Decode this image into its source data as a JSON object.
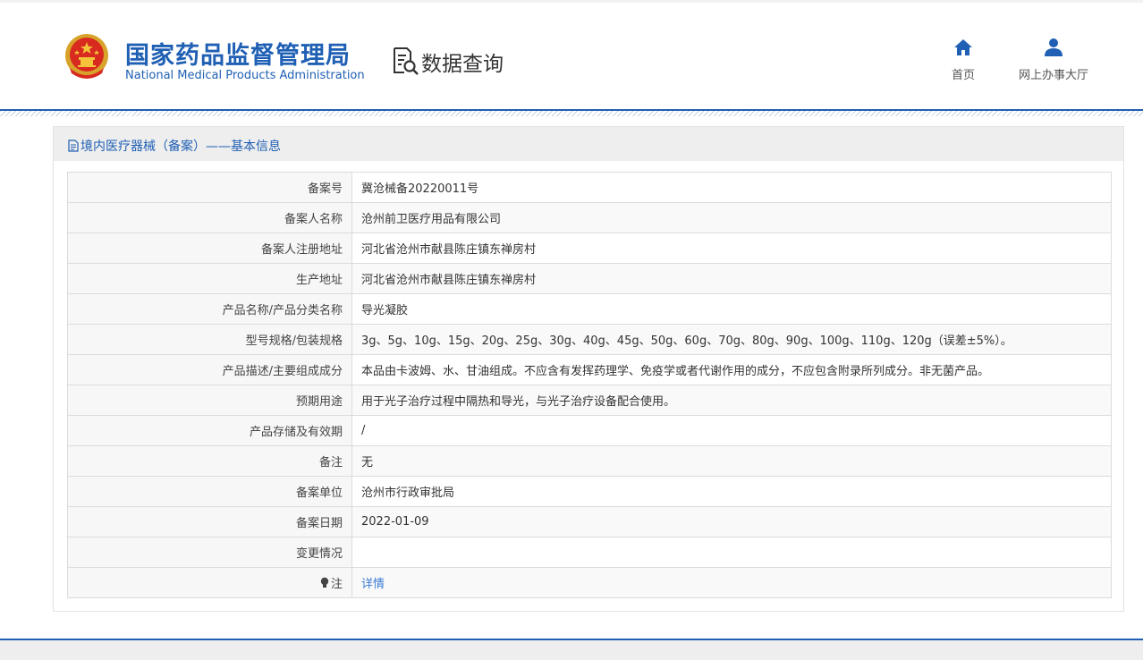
{
  "header": {
    "org_name_cn": "国家药品监督管理局",
    "org_name_en": "National Medical Products Administration",
    "section_title": "数据查询",
    "nav": {
      "home_label": "首页",
      "service_hall_label": "网上办事大厅"
    }
  },
  "panel": {
    "title": "境内医疗器械（备案）——基本信息"
  },
  "records": [
    {
      "label": "备案号",
      "value": "冀沧械备20220011号"
    },
    {
      "label": "备案人名称",
      "value": "沧州前卫医疗用品有限公司"
    },
    {
      "label": "备案人注册地址",
      "value": "河北省沧州市献县陈庄镇东禅房村"
    },
    {
      "label": "生产地址",
      "value": "河北省沧州市献县陈庄镇东禅房村"
    },
    {
      "label": "产品名称/产品分类名称",
      "value": "导光凝胶"
    },
    {
      "label": "型号规格/包装规格",
      "value": "3g、5g、10g、15g、20g、25g、30g、40g、45g、50g、60g、70g、80g、90g、100g、110g、120g（误差±5%）。"
    },
    {
      "label": "产品描述/主要组成成分",
      "value": "本品由卡波姆、水、甘油组成。不应含有发挥药理学、免疫学或者代谢作用的成分，不应包含附录所列成分。非无菌产品。"
    },
    {
      "label": "预期用途",
      "value": "用于光子治疗过程中隔热和导光，与光子治疗设备配合使用。"
    },
    {
      "label": "产品存储及有效期",
      "value": "/"
    },
    {
      "label": "备注",
      "value": "无"
    },
    {
      "label": "备案单位",
      "value": "沧州市行政审批局"
    },
    {
      "label": "备案日期",
      "value": "2022-01-09"
    },
    {
      "label": "变更情况",
      "value": ""
    }
  ],
  "note_row": {
    "label": "注",
    "link_text": "详情"
  },
  "colors": {
    "brand_blue": "#1f5fb4",
    "link_blue": "#3a7bd5"
  },
  "icons": [
    "national-emblem-icon",
    "data-query-icon",
    "home-icon",
    "user-icon",
    "document-icon",
    "bulb-icon"
  ]
}
